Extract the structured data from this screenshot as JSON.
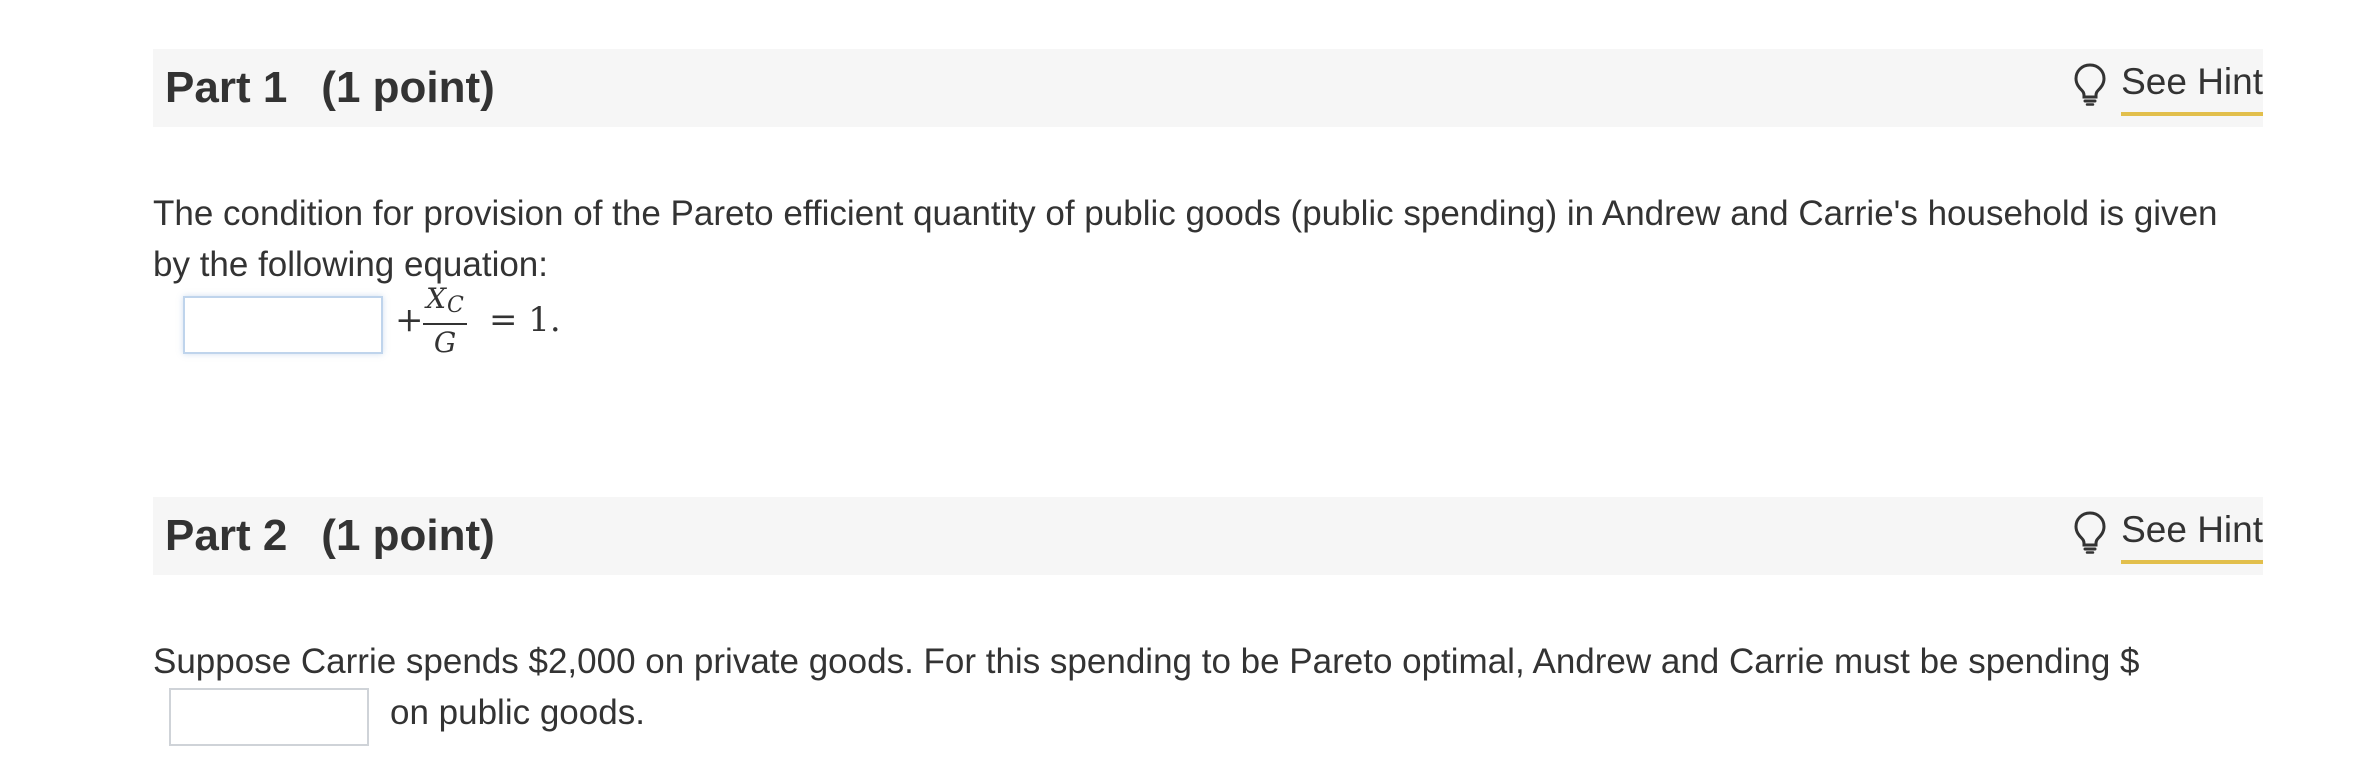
{
  "part1": {
    "title": "Part 1",
    "points": "(1 point)",
    "hint_label": "See Hint",
    "question": "The condition for provision of the Pareto efficient quantity of public goods (public spending) in Andrew and Carrie's household is given by the following equation:",
    "answer_value": "",
    "equation": {
      "plus": "+",
      "numerator": "X",
      "numerator_sub": "C",
      "denominator": "G",
      "rhs": "= 1."
    }
  },
  "part2": {
    "title": "Part 2",
    "points": "(1 point)",
    "hint_label": "See Hint",
    "question": "Suppose Carrie spends $2,000 on private goods. For this spending to be Pareto optimal, Andrew and Carrie must be spending $",
    "answer_value": "",
    "question_suffix": "on public goods."
  },
  "colors": {
    "header_bg": "#f6f6f6",
    "text": "#333333",
    "hint_underline": "#e2bf4c",
    "input_border": "#cfd3d8"
  },
  "icons": {
    "hint": "lightbulb-icon"
  }
}
